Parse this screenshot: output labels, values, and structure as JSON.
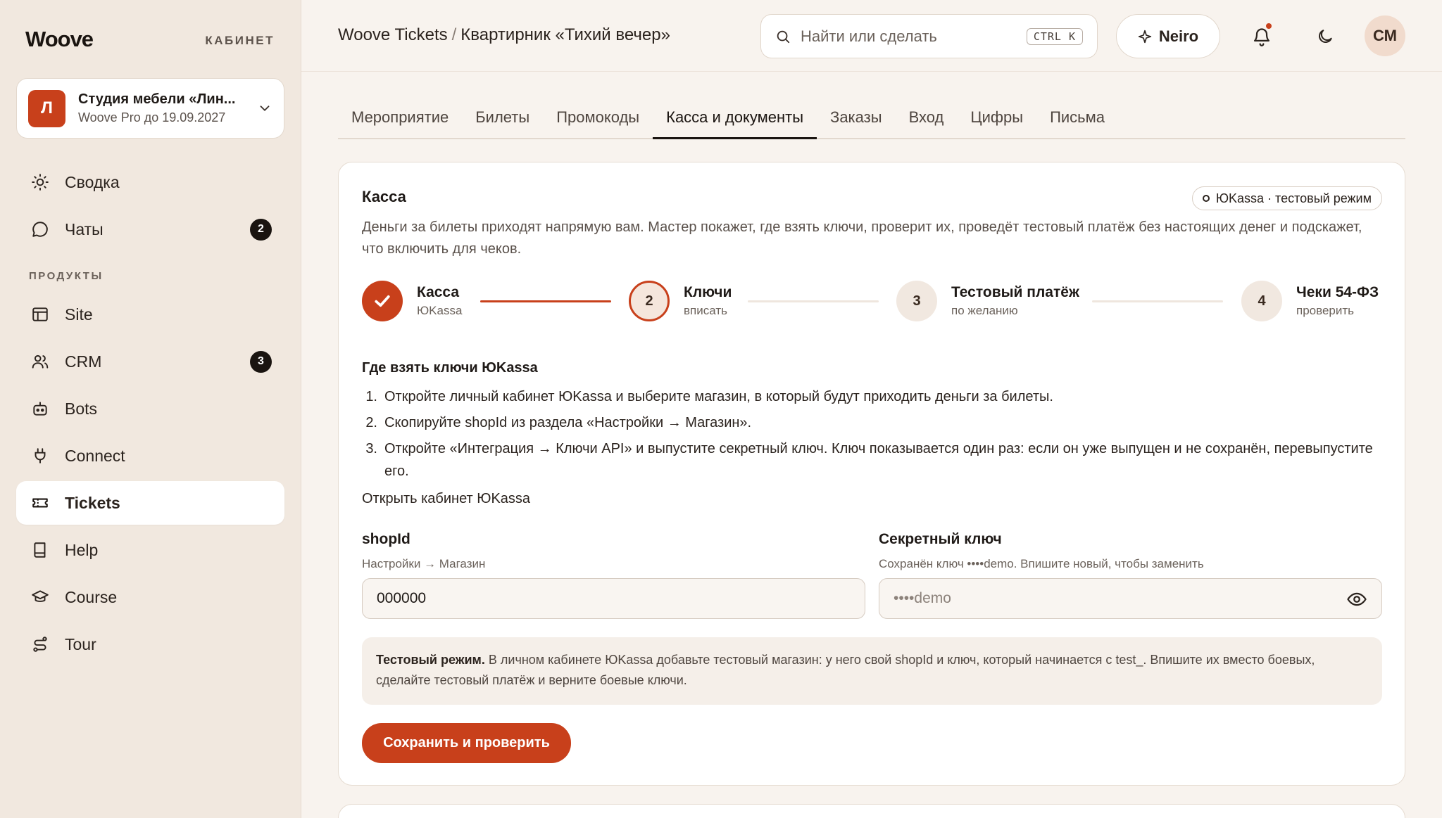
{
  "sidebar": {
    "brand": "Woove",
    "brand_tag": "КАБИНЕТ",
    "workspace": {
      "initial": "Л",
      "name": "Студия мебели «Лин...",
      "plan": "Woove Pro до 19.09.2027"
    },
    "section_label": "ПРОДУКТЫ",
    "items": [
      {
        "label": "Сводка",
        "icon": "sun-icon"
      },
      {
        "label": "Чаты",
        "icon": "chat-icon",
        "badge": "2"
      },
      {
        "label": "Site",
        "icon": "layout-icon"
      },
      {
        "label": "CRM",
        "icon": "users-icon",
        "badge": "3"
      },
      {
        "label": "Bots",
        "icon": "bot-icon"
      },
      {
        "label": "Connect",
        "icon": "plug-icon"
      },
      {
        "label": "Tickets",
        "icon": "ticket-icon",
        "active": true
      },
      {
        "label": "Help",
        "icon": "book-icon"
      },
      {
        "label": "Course",
        "icon": "graduation-cap-icon"
      },
      {
        "label": "Tour",
        "icon": "route-icon"
      }
    ]
  },
  "header": {
    "breadcrumb": {
      "root": "Woove Tickets",
      "separator": "/",
      "current": "Квартирник «Тихий вечер»"
    },
    "search": {
      "placeholder": "Найти или сделать",
      "shortcut": "CTRL K"
    },
    "neiro_label": "Neiro",
    "user_initials": "СМ"
  },
  "tabs": [
    {
      "label": "Мероприятие"
    },
    {
      "label": "Билеты"
    },
    {
      "label": "Промокоды"
    },
    {
      "label": "Касса и документы",
      "active": true
    },
    {
      "label": "Заказы"
    },
    {
      "label": "Вход"
    },
    {
      "label": "Цифры"
    },
    {
      "label": "Письма"
    }
  ],
  "card": {
    "title": "Касса",
    "status": "ЮKassa · тестовый режим",
    "description": "Деньги за билеты приходят напрямую вам. Мастер покажет, где взять ключи, проверит их, проведёт тестовый платёж без настоящих денег и подскажет, что включить для чеков.",
    "steps": [
      {
        "number": "1",
        "title": "Касса",
        "subtitle": "ЮKassa",
        "state": "done"
      },
      {
        "number": "2",
        "title": "Ключи",
        "subtitle": "вписать",
        "state": "current"
      },
      {
        "number": "3",
        "title": "Тестовый платёж",
        "subtitle": "по желанию",
        "state": "todo"
      },
      {
        "number": "4",
        "title": "Чеки 54-ФЗ",
        "subtitle": "проверить",
        "state": "todo"
      }
    ],
    "help_title": "Где взять ключи ЮKassa",
    "help_steps": [
      "Откройте личный кабинет ЮKassa и выберите магазин, в который будут приходить деньги за билеты.",
      "Скопируйте shopId из раздела «Настройки → Магазин».",
      "Откройте «Интеграция → Ключи API» и выпустите секретный ключ. Ключ показывается один раз: если он уже выпущен и не сохранён, перевыпустите его."
    ],
    "help_link": "Открыть кабинет ЮKassa",
    "shop_id": {
      "label": "shopId",
      "hint": "Настройки → Магазин",
      "value": "000000"
    },
    "secret_key": {
      "label": "Секретный ключ",
      "hint": "Сохранён ключ ••••demo. Впишите новый, чтобы заменить",
      "placeholder": "••••demo"
    },
    "note_bold": "Тестовый режим.",
    "note_text": " В личном кабинете ЮKassa добавьте тестовый магазин: у него свой shopId и ключ, который начинается с test_. Впишите их вместо боевых, сделайте тестовый платёж и верните боевые ключи.",
    "save_button": "Сохранить и проверить"
  },
  "colors": {
    "accent": "#c8401b",
    "background": "#f8f3ee",
    "sidebar": "#f1e8df",
    "text": "#1f1a17"
  }
}
